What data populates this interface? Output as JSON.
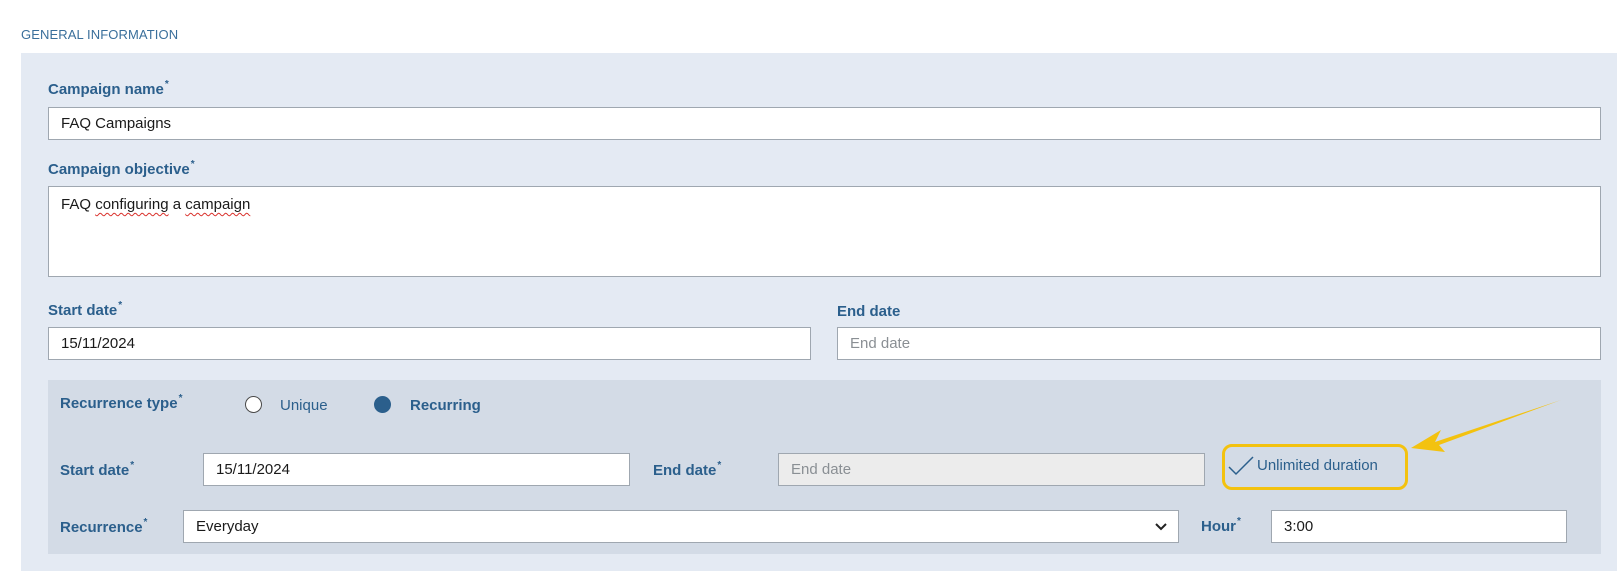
{
  "section": {
    "title": "GENERAL INFORMATION"
  },
  "campaign_name": {
    "label": "Campaign name",
    "required": "*",
    "value": "FAQ Campaigns"
  },
  "campaign_objective": {
    "label": "Campaign objective",
    "required": "*",
    "value_prefix": "FAQ ",
    "value_misspelled_1": "configuring",
    "value_mid": " a ",
    "value_misspelled_2": "campaign"
  },
  "start_date": {
    "label": "Start date",
    "required": "*",
    "value": "15/11/2024"
  },
  "end_date": {
    "label": "End date",
    "placeholder": "End date"
  },
  "recurrence_section": {
    "type_label": "Recurrence type",
    "required": "*",
    "options": [
      {
        "label": "Unique",
        "selected": false
      },
      {
        "label": "Recurring",
        "selected": true
      }
    ],
    "start_label": "Start date",
    "start_value": "15/11/2024",
    "end_label": "End date",
    "end_placeholder": "End date",
    "unlimited_label": "Unlimited duration",
    "unlimited_checked": true,
    "recurrence_label": "Recurrence",
    "recurrence_value": "Everyday",
    "hour_label": "Hour",
    "hour_value": "3:00"
  },
  "colors": {
    "accent": "#2b5f8c",
    "highlight": "#f3c20f",
    "panel": "#e4eaf3",
    "subpanel": "#d3dbe6"
  },
  "icons": {
    "check": "check-icon",
    "chevron": "chevron-down-icon",
    "arrow": "annotation-arrow"
  }
}
